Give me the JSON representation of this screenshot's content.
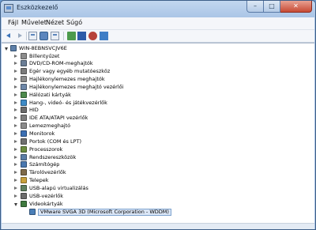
{
  "window": {
    "title": "Eszközkezelő"
  },
  "menu": [
    "Fájl",
    "Művelet",
    "Nézet",
    "Súgó"
  ],
  "tree": {
    "root": "WIN-8EBNSVCJV6E",
    "categories": [
      "Billentyűzet",
      "DVD/CD-ROM-meghajtók",
      "Egér vagy egyéb mutatóeszköz",
      "Hajlékonylemezes meghajtók",
      "Hajlékonylemezes meghajtó vezérlői",
      "Hálózati kártyák",
      "Hang-, videó- és játékvezérlők",
      "HID",
      "IDE ATA/ATAPI vezérlők",
      "Lemezmeghajtó",
      "Monitorok",
      "Portok (COM és LPT)",
      "Processzorok",
      "Rendszereszközök",
      "Számítógép",
      "Tárolóvezérlők",
      "Telepek",
      "USB-alapú virtualizálás",
      "USB-vezérlők"
    ],
    "expanded_category": "Videokártyák",
    "selected_device": "VMware SVGA 3D (Microsoft Corporation - WDDM)"
  },
  "icon_colors": [
    "#8c8c8c",
    "#6b7e96",
    "#7a7a7a",
    "#8a8a8a",
    "#6d87a8",
    "#4d8a4d",
    "#3e8bc7",
    "#6a6a6a",
    "#7d7d7d",
    "#8a8a8a",
    "#3b6fb3",
    "#6f6f6f",
    "#6b8c3e",
    "#5c7ea6",
    "#4a78b0",
    "#7f6a4a",
    "#c9a13c",
    "#5f7f5f",
    "#6b6b6b"
  ]
}
